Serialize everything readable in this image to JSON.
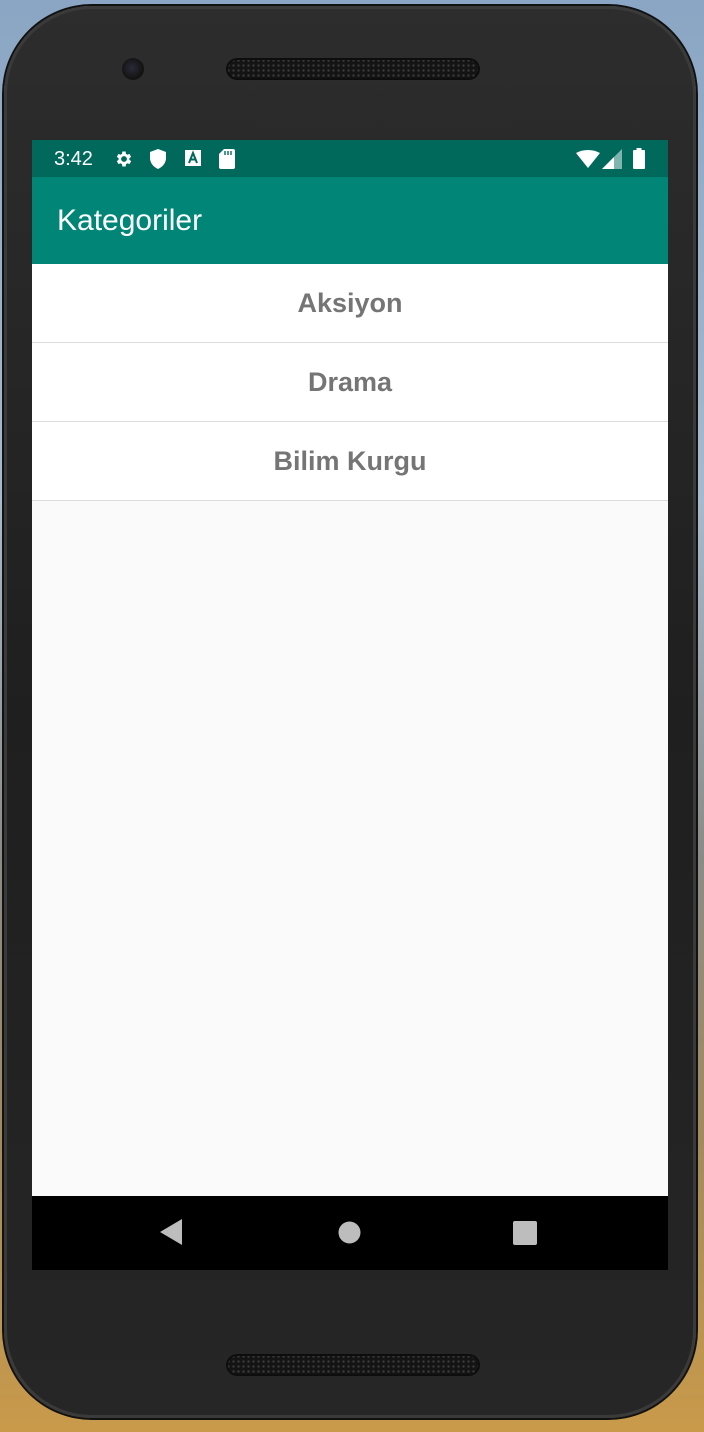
{
  "status_bar": {
    "time": "3:42",
    "left_icons": [
      "gear-icon",
      "shield-icon",
      "a-box-icon",
      "sd-card-icon"
    ],
    "right_icons": [
      "wifi-icon",
      "signal-icon",
      "battery-icon"
    ]
  },
  "app_bar": {
    "title": "Kategoriler"
  },
  "categories": [
    {
      "label": "Aksiyon"
    },
    {
      "label": "Drama"
    },
    {
      "label": "Bilim Kurgu"
    }
  ],
  "nav_bar": {
    "buttons": [
      "back-icon",
      "home-icon",
      "recents-icon"
    ]
  },
  "colors": {
    "status_bar": "#00695c",
    "app_bar": "#008577",
    "list_text": "#757575",
    "background": "#fafafa"
  }
}
